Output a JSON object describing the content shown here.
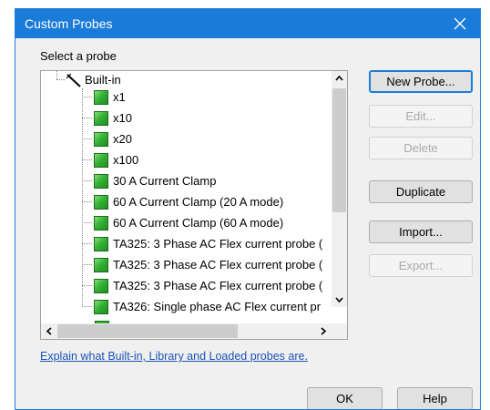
{
  "window": {
    "title": "Custom Probes"
  },
  "label": "Select a probe",
  "tree": {
    "root": "Built-in",
    "items": [
      "x1",
      "x10",
      "x20",
      "x100",
      "30 A Current Clamp",
      "60 A Current Clamp (20 A mode)",
      "60 A Current Clamp (60 A mode)",
      "TA325: 3 Phase AC Flex current probe (",
      "TA325: 3 Phase AC Flex current probe (",
      "TA325: 3 Phase AC Flex current probe (",
      "TA326: Single phase AC Flex current pr"
    ]
  },
  "buttons": {
    "new_probe": "New Probe...",
    "edit": "Edit...",
    "delete": "Delete",
    "duplicate": "Duplicate",
    "import": "Import...",
    "export": "Export..."
  },
  "link": "Explain what Built-in, Library and Loaded probes are.",
  "footer": {
    "ok": "OK",
    "help": "Help"
  }
}
